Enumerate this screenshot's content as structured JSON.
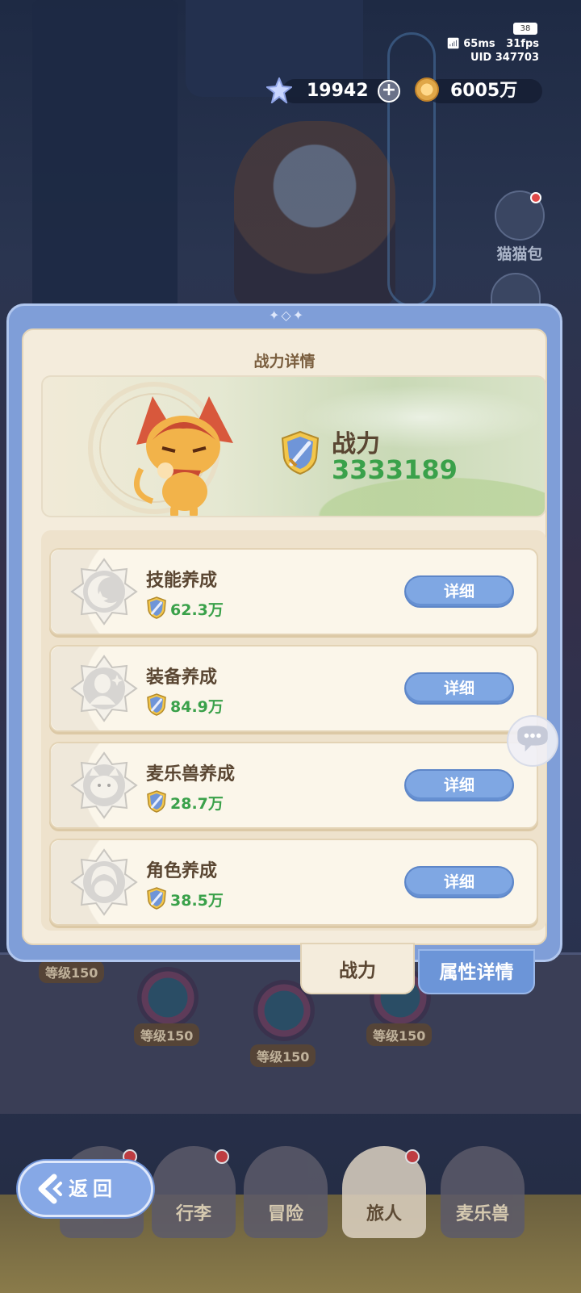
{
  "status": {
    "battery": "38",
    "ping": "65ms",
    "fps": "31fps",
    "uid": "UID 347703"
  },
  "currency": {
    "gems": "19942",
    "coins": "6005万"
  },
  "side": {
    "bag_label": "猫猫包"
  },
  "panel": {
    "title": "战力详情",
    "power_label": "战力",
    "power_value": "3333189",
    "rows": [
      {
        "name": "技能养成",
        "value": "62.3万",
        "button": "详细"
      },
      {
        "name": "装备养成",
        "value": "84.9万",
        "button": "详细"
      },
      {
        "name": "麦乐兽养成",
        "value": "28.7万",
        "button": "详细"
      },
      {
        "name": "角色养成",
        "value": "38.5万",
        "button": "详细"
      }
    ]
  },
  "tabs": {
    "power": "战力",
    "attributes": "属性详情"
  },
  "background_levels": [
    "等级150",
    "等级150",
    "等级150",
    "等级150"
  ],
  "nav": {
    "back": "返回",
    "items": [
      "行李",
      "冒险",
      "旅人",
      "麦乐兽"
    ]
  },
  "colors": {
    "accent_blue": "#7fa7e3",
    "power_green": "#3aa14a",
    "panel_blue": "#7f9ed8"
  }
}
